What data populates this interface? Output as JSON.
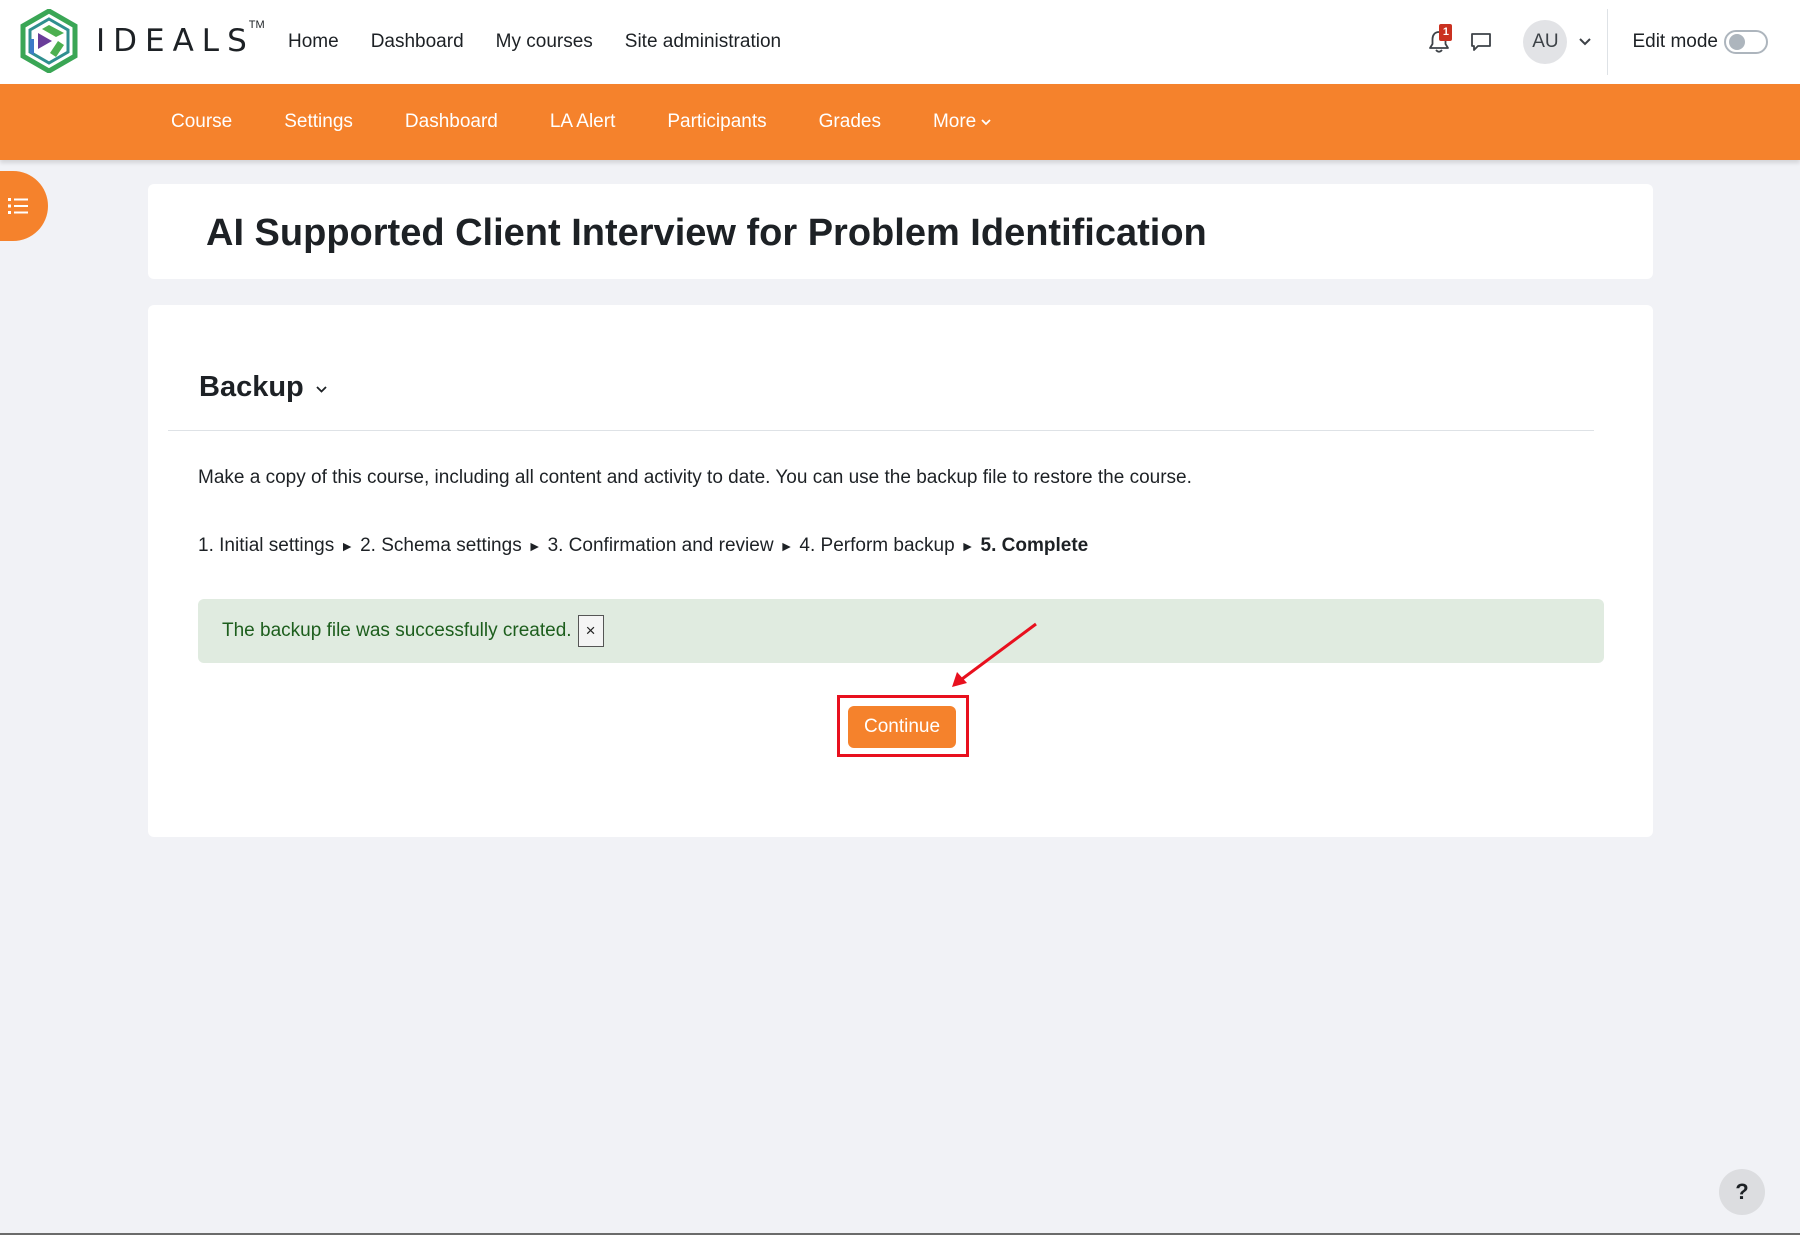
{
  "brand": {
    "name": "IDEALS",
    "tm": "TM"
  },
  "primary_nav": [
    "Home",
    "Dashboard",
    "My courses",
    "Site administration"
  ],
  "notifications": {
    "count": "1"
  },
  "user": {
    "initials": "AU"
  },
  "edit_mode": {
    "label": "Edit mode",
    "enabled": false
  },
  "secondary_nav": [
    "Course",
    "Settings",
    "Dashboard",
    "LA Alert",
    "Participants",
    "Grades",
    "More"
  ],
  "page": {
    "title": "AI Supported Client Interview for Problem Identification"
  },
  "section": {
    "heading": "Backup"
  },
  "description": "Make a copy of this course, including all content and activity to date. You can use the backup file to restore the course.",
  "steps": {
    "items": [
      "1. Initial settings",
      "2. Schema settings",
      "3. Confirmation and review",
      "4. Perform backup",
      "5. Complete"
    ],
    "current_index": 4,
    "separator": "►"
  },
  "alert": {
    "message": "The backup file was successfully created.",
    "close_label": "×"
  },
  "continue_button": {
    "label": "Continue"
  },
  "help": {
    "label": "?"
  },
  "colors": {
    "accent": "#f5822c",
    "annotation": "#e8101e",
    "success_bg": "#e0ebe0"
  }
}
